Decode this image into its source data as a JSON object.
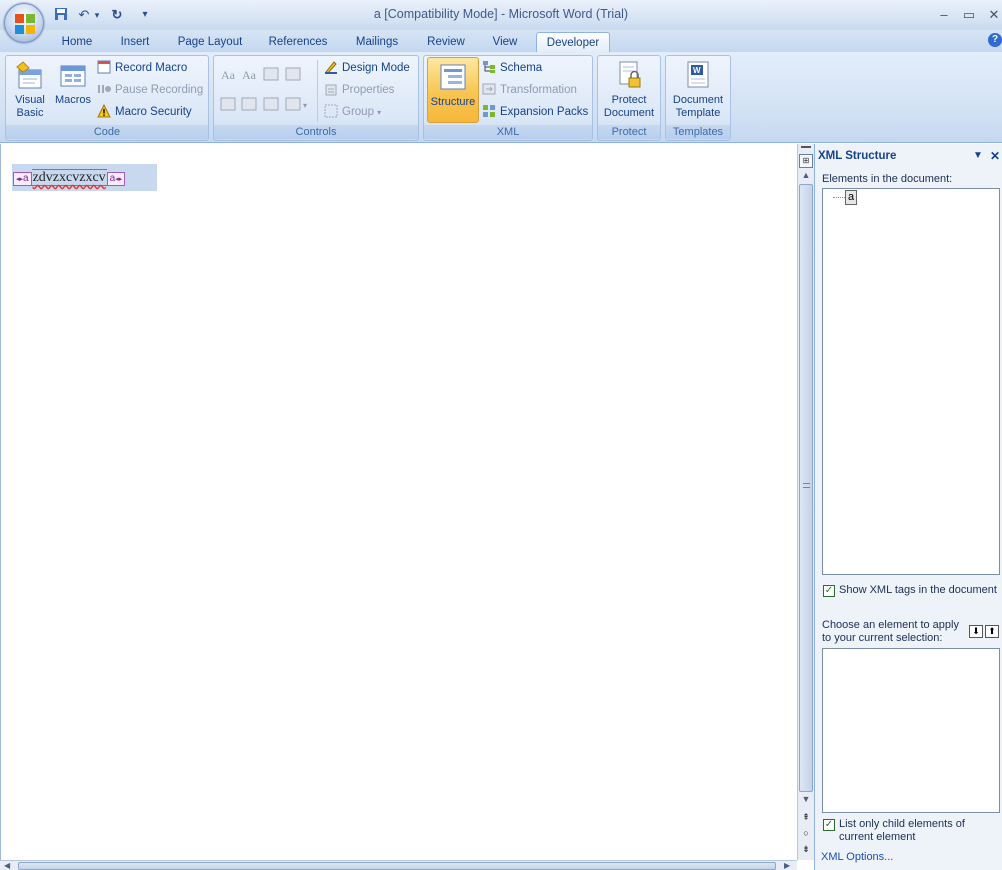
{
  "window": {
    "title": "a [Compatibility Mode] - Microsoft Word (Trial)",
    "minimize": "–",
    "restore": "▭",
    "close": "✕"
  },
  "qat": {
    "save": "💾",
    "undo": "↶",
    "dropdown": "▾",
    "redo": "↻",
    "customize": "▾"
  },
  "tabs": [
    {
      "label": "Home"
    },
    {
      "label": "Insert"
    },
    {
      "label": "Page Layout"
    },
    {
      "label": "References"
    },
    {
      "label": "Mailings"
    },
    {
      "label": "Review"
    },
    {
      "label": "View"
    },
    {
      "label": "Developer",
      "active": true
    }
  ],
  "help": "?",
  "ribbon": {
    "code": {
      "label": "Code",
      "visual_basic": "Visual Basic",
      "visual_basic_l1": "Visual",
      "visual_basic_l2": "Basic",
      "macros": "Macros",
      "record_macro": "Record Macro",
      "pause_recording": "Pause Recording",
      "macro_security": "Macro Security"
    },
    "controls": {
      "label": "Controls",
      "design_mode": "Design Mode",
      "properties": "Properties",
      "group": "Group"
    },
    "xml": {
      "label": "XML",
      "structure": "Structure",
      "schema": "Schema",
      "transformation": "Transformation",
      "expansion_packs": "Expansion Packs"
    },
    "protect": {
      "label": "Protect",
      "protect_document_l1": "Protect",
      "protect_document_l2": "Document"
    },
    "templates": {
      "label": "Templates",
      "document_template_l1": "Document",
      "document_template_l2": "Template"
    }
  },
  "document": {
    "tag_name": "a",
    "content": "zdvzxcvzxcv"
  },
  "xml_panel": {
    "title": "XML Structure",
    "elements_label": "Elements in the document:",
    "tree_items": [
      "a"
    ],
    "show_tags_label": "Show XML tags in the document",
    "show_tags_checked": true,
    "choose_label_l1": "Choose an element to apply",
    "choose_label_l2": "to your current selection:",
    "list_child_l1": "List only child elements of",
    "list_child_l2": "current element",
    "list_child_checked": true,
    "xml_options": "XML Options..."
  }
}
